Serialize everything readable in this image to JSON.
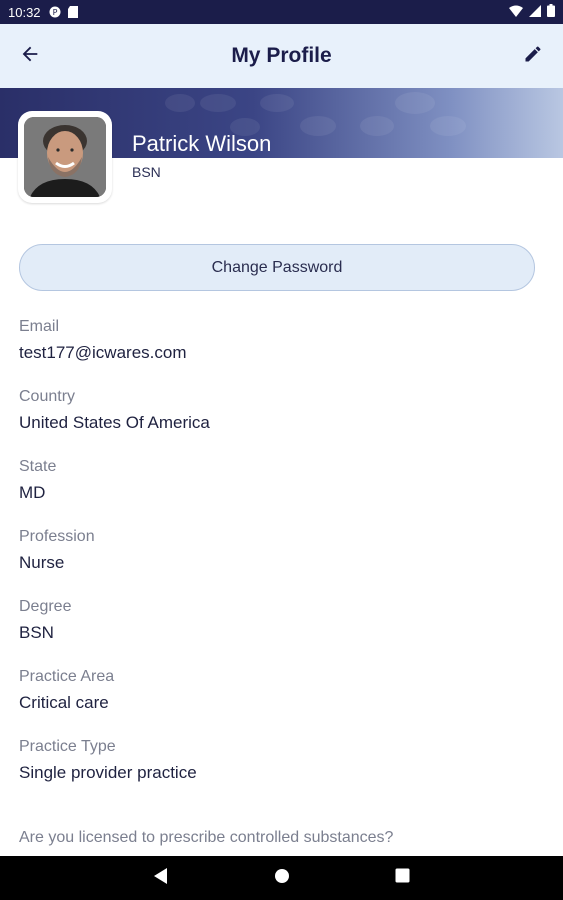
{
  "status_bar": {
    "time": "10:32"
  },
  "app_bar": {
    "title": "My Profile"
  },
  "profile": {
    "name": "Patrick Wilson",
    "degree": "BSN"
  },
  "actions": {
    "change_password": "Change Password"
  },
  "fields": [
    {
      "label": "Email",
      "value": "test177@icwares.com"
    },
    {
      "label": "Country",
      "value": "United States Of America"
    },
    {
      "label": "State",
      "value": "MD"
    },
    {
      "label": "Profession",
      "value": "Nurse"
    },
    {
      "label": "Degree",
      "value": "BSN"
    },
    {
      "label": "Practice Area",
      "value": "Critical care"
    },
    {
      "label": "Practice Type",
      "value": "Single provider practice"
    }
  ],
  "question": "Are you licensed to prescribe controlled substances?",
  "colors": {
    "status_bar": "#1b1d4a",
    "app_bar": "#e8f1fb",
    "title": "#1b1d4a",
    "button_bg": "#e2ecf8",
    "label": "#7b7f8f",
    "value": "#1f2240"
  },
  "icons": {
    "back": "arrow-left-icon",
    "edit": "pencil-icon",
    "nav_back": "triangle-back-icon",
    "nav_home": "circle-home-icon",
    "nav_recents": "square-recents-icon"
  }
}
